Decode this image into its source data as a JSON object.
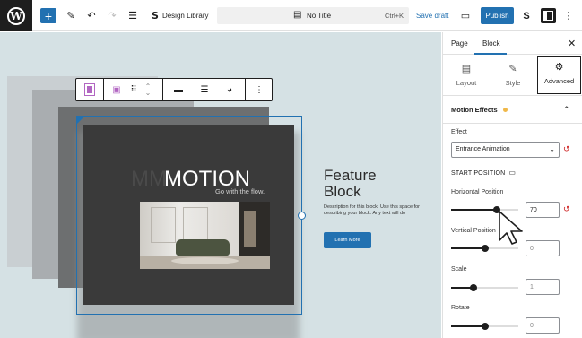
{
  "topbar": {
    "logo_icon": "wordpress-logo",
    "add_block_label": "+",
    "design_library_label": "Design Library",
    "doc_title": "No Title",
    "shortcut": "Ctrl+K",
    "save_draft_label": "Save draft",
    "publish_label": "Publish",
    "icons": [
      "plus-icon",
      "pencil-icon",
      "undo-icon",
      "redo-icon",
      "list-view-icon",
      "stackable-icon",
      "document-icon",
      "desktop-preview-icon",
      "stackable-icon",
      "sidebar-toggle-icon",
      "more-vertical-icon"
    ],
    "accent_color": "#2271b1"
  },
  "canvas": {
    "motion_ghost_text": "MM",
    "motion_title": "MOTION",
    "motion_subtitle": "Go with the flow.",
    "feature_title_line1": "Feature",
    "feature_title_line2": "Block",
    "feature_description": "Description for this block. Use this space for describing your block. Any text will do",
    "learn_more_label": "Learn More",
    "background_color": "#d5e1e4"
  },
  "block_toolbar": {
    "icons": [
      "columns-icon",
      "image-icon",
      "drag-handle-icon",
      "move-arrows-icon",
      "align-icon",
      "justify-icon",
      "stackable-icon",
      "more-options-icon"
    ]
  },
  "sidebar": {
    "tabs": [
      {
        "label": "Page"
      },
      {
        "label": "Block",
        "active": true
      }
    ],
    "close_icon": "close-icon",
    "subtabs": [
      {
        "label": "Layout",
        "icon": "layout-icon"
      },
      {
        "label": "Style",
        "icon": "brush-icon"
      },
      {
        "label": "Advanced",
        "icon": "gear-icon",
        "active": true
      }
    ],
    "section_title": "Motion Effects",
    "section_indicator_color": "#f0b849",
    "effect_label": "Effect",
    "effect_value": "Entrance Animation",
    "start_position_title": "START POSITION",
    "horizontal_label": "Horizontal Position",
    "horizontal_value": "70",
    "horizontal_level": 0.68,
    "vertical_label": "Vertical Position",
    "vertical_value": "",
    "vertical_placeholder": "0",
    "vertical_level": 0.5,
    "scale_label": "Scale",
    "scale_value": "",
    "scale_placeholder": "1",
    "scale_level": 0.33,
    "rotate_label": "Rotate",
    "rotate_value": "",
    "rotate_placeholder": "0",
    "rotate_level": 0.5
  }
}
